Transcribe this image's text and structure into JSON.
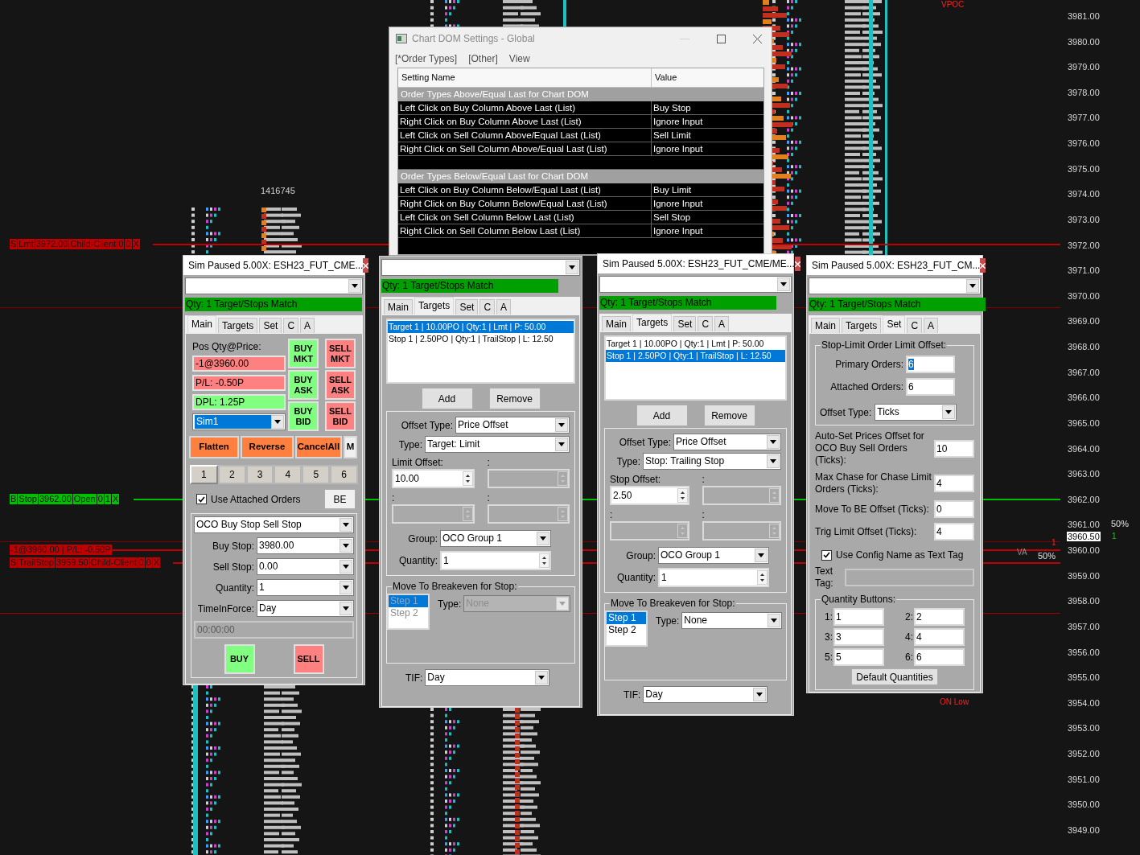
{
  "chart": {
    "price_labels": [
      "3981.00",
      "3980.00",
      "3979.00",
      "3978.00",
      "3977.00",
      "3976.00",
      "3975.00",
      "3974.00",
      "3973.00",
      "3972.00",
      "3971.00",
      "3970.00",
      "3969.00",
      "3968.00",
      "3967.00",
      "3966.00",
      "3965.00",
      "3964.00",
      "3963.00",
      "3962.00",
      "3961.00",
      "3960.00",
      "3959.00",
      "3958.00",
      "3957.00",
      "3956.00",
      "3955.00",
      "3954.00",
      "3953.00",
      "3952.00",
      "3951.00",
      "3950.00",
      "3949.00"
    ],
    "last_price": "3960.50",
    "volume": "1416745",
    "vpoc": "VPOC",
    "on_low": "ON Low",
    "va": "VA",
    "ratios": [
      "50%",
      "50%"
    ],
    "counts": [
      "1",
      "1"
    ],
    "order_labels": [
      {
        "kind": "sell",
        "cells": [
          "S",
          "Lmt",
          "3972.00",
          "Child-Client",
          "0",
          "0",
          "X"
        ]
      },
      {
        "kind": "buy",
        "cells": [
          "B",
          "Stop",
          "3962.00",
          "Open",
          "0",
          "1",
          "X"
        ]
      },
      {
        "kind": "sell",
        "cells": [
          "-1@3960.00 | P/L: -0.50P"
        ]
      },
      {
        "kind": "sell",
        "cells": [
          "S",
          "TrailStop",
          "3959.50",
          "Child-Client",
          "0",
          "0",
          "X"
        ]
      }
    ]
  },
  "settings_dialog": {
    "title": "Chart DOM Settings - Global",
    "menu": [
      "[*Order Types]",
      "[Other]",
      "View"
    ],
    "columns": [
      "Setting Name",
      "Value"
    ],
    "sections": [
      {
        "title": "Order Types Above/Equal Last for Chart DOM",
        "rows": [
          {
            "name": "Left Click on Buy Column Above Last (List)",
            "value": "Buy Stop"
          },
          {
            "name": "Right Click on Buy Column Above Last (List)",
            "value": "Ignore Input"
          },
          {
            "name": "Left Click on Sell Column Above/Equal Last (List)",
            "value": "Sell Limit"
          },
          {
            "name": "Right Click on Sell Column Above/Equal Last (List)",
            "value": "Ignore Input"
          }
        ]
      },
      {
        "title": "Order Types Below/Equal Last for Chart DOM",
        "rows": [
          {
            "name": "Left Click on Buy Column Below/Equal Last (List)",
            "value": "Buy Limit"
          },
          {
            "name": "Right Click on Buy Column Below/Equal Last (List)",
            "value": "Ignore Input"
          },
          {
            "name": "Left Click on Sell Column Below Last (List)",
            "value": "Sell Stop"
          },
          {
            "name": "Right Click on Sell Column Below Last (List)",
            "value": "Ignore Input"
          }
        ]
      }
    ]
  },
  "trade_windows": [
    {
      "title": "Sim Paused 5.00X: ESH23_FUT_CME...",
      "status": "Qty: 1 Target/Stops Match",
      "tabs": [
        {
          "label": "Main",
          "selected": true
        },
        {
          "label": "Targets",
          "selected": false
        },
        {
          "label": "Set",
          "selected": false
        },
        {
          "label": "C",
          "selected": false
        },
        {
          "label": "A",
          "selected": false
        }
      ],
      "panel": {
        "kind": "main",
        "position_label": "Pos Qty@Price:",
        "readouts": [
          {
            "text": "-1@3960.00",
            "kind": "loss"
          },
          {
            "text": "P/L: -0.50P",
            "kind": "loss"
          },
          {
            "text": "DPL: 1.25P",
            "kind": "gain"
          }
        ],
        "account": "Sim1",
        "order_buttons": [
          {
            "label": "BUY MKT",
            "kind": "buy"
          },
          {
            "label": "SELL MKT",
            "kind": "sell"
          },
          {
            "label": "BUY ASK",
            "kind": "buy"
          },
          {
            "label": "SELL ASK",
            "kind": "sell"
          },
          {
            "label": "BUY BID",
            "kind": "buy"
          },
          {
            "label": "SELL BID",
            "kind": "sell"
          }
        ],
        "actions": [
          {
            "label": "Flatten",
            "kind": "accent"
          },
          {
            "label": "Reverse",
            "kind": "accent"
          },
          {
            "label": "CancelAll",
            "kind": "accent"
          },
          {
            "label": "M",
            "kind": "plain"
          }
        ],
        "quantity_buttons": [
          {
            "label": "1",
            "selected": true
          },
          {
            "label": "2",
            "selected": false
          },
          {
            "label": "3",
            "selected": false
          },
          {
            "label": "4",
            "selected": false
          },
          {
            "label": "5",
            "selected": false
          },
          {
            "label": "6",
            "selected": false
          }
        ],
        "attached": {
          "label": "Use Attached Orders",
          "checked": true
        },
        "be_button": "BE",
        "order_type": "OCO Buy Stop Sell Stop",
        "fields": [
          {
            "label": "Buy Stop:",
            "value": "3980.00"
          },
          {
            "label": "Sell Stop:",
            "value": "0.00"
          },
          {
            "label": "Quantity:",
            "value": "1"
          },
          {
            "label": "TimeInForce:",
            "value": "Day"
          }
        ],
        "time": {
          "value": "00:00:00",
          "disabled": true
        },
        "buy": "BUY",
        "sell": "SELL"
      }
    },
    {
      "status": "Qty: 1 Target/Stops Match",
      "tabs": [
        {
          "label": "Main",
          "selected": false
        },
        {
          "label": "Targets",
          "selected": true
        },
        {
          "label": "Set",
          "selected": false
        },
        {
          "label": "C",
          "selected": false
        },
        {
          "label": "A",
          "selected": false
        }
      ],
      "panel": {
        "kind": "targets",
        "orders": [
          {
            "text": "Target 1 | 10.00PO | Qty:1 | Lmt | P: 50.00",
            "selected": true
          },
          {
            "text": "Stop 1 | 2.50PO | Qty:1 | TrailStop | L: 12.50",
            "selected": false
          }
        ],
        "buttons": [
          "Add",
          "Remove"
        ],
        "offset_type": {
          "label": "Offset Type:",
          "value": "Price Offset"
        },
        "type": {
          "label": "Type:",
          "value": "Target: Limit"
        },
        "offsets": [
          {
            "label": "Limit Offset:",
            "value": "10.00",
            "disabled": false
          },
          {
            "label": ":",
            "disabled": true
          },
          {
            "label": ":",
            "disabled": true
          },
          {
            "label": ":",
            "disabled": true
          }
        ],
        "group": {
          "label": "Group:",
          "value": "OCO Group 1"
        },
        "quantity": {
          "label": "Quantity:",
          "value": "1"
        },
        "breakeven": {
          "title": "Move To Breakeven for Stop:",
          "disabled": true,
          "steps": [
            {
              "label": "Step 1",
              "selected": true
            },
            {
              "label": "Step 2",
              "selected": false
            }
          ],
          "type_label": "Type:",
          "type_value": "None"
        },
        "tif": {
          "label": "TIF:",
          "value": "Day"
        }
      }
    },
    {
      "title": "Sim Paused 5.00X: ESH23_FUT_CME/ME...",
      "status": "Qty: 1 Target/Stops Match",
      "tabs": [
        {
          "label": "Main",
          "selected": false
        },
        {
          "label": "Targets",
          "selected": true
        },
        {
          "label": "Set",
          "selected": false
        },
        {
          "label": "C",
          "selected": false
        },
        {
          "label": "A",
          "selected": false
        }
      ],
      "panel": {
        "kind": "targets",
        "orders": [
          {
            "text": "Target 1 | 10.00PO | Qty:1 | Lmt | P: 50.00",
            "selected": false
          },
          {
            "text": "Stop 1 | 2.50PO | Qty:1 | TrailStop | L: 12.50",
            "selected": true
          }
        ],
        "buttons": [
          "Add",
          "Remove"
        ],
        "offset_type": {
          "label": "Offset Type:",
          "value": "Price Offset"
        },
        "type": {
          "label": "Type:",
          "value": "Stop: Trailing Stop"
        },
        "offsets": [
          {
            "label": "Stop Offset:",
            "value": "2.50",
            "disabled": false
          },
          {
            "label": ":",
            "disabled": true
          },
          {
            "label": ":",
            "disabled": true
          },
          {
            "label": ":",
            "disabled": true
          }
        ],
        "group": {
          "label": "Group:",
          "value": "OCO Group 1"
        },
        "quantity": {
          "label": "Quantity:",
          "value": "1"
        },
        "breakeven": {
          "title": "Move To Breakeven for Stop:",
          "disabled": false,
          "steps": [
            {
              "label": "Step 1",
              "selected": true
            },
            {
              "label": "Step 2",
              "selected": false
            }
          ],
          "type_label": "Type:",
          "type_value": "None"
        },
        "tif": {
          "label": "TIF:",
          "value": "Day"
        }
      }
    },
    {
      "title": "Sim Paused 5.00X: ESH23_FUT_CM...",
      "status": "Qty: 1 Target/Stops Match",
      "tabs": [
        {
          "label": "Main",
          "selected": false
        },
        {
          "label": "Targets",
          "selected": false
        },
        {
          "label": "Set",
          "selected": true
        },
        {
          "label": "C",
          "selected": false
        },
        {
          "label": "A",
          "selected": false
        }
      ],
      "panel": {
        "kind": "set",
        "limit_offset": {
          "title": "Stop-Limit Order Limit Offset:",
          "fields": [
            {
              "label": "Primary Orders:",
              "value": "6",
              "selected": true
            },
            {
              "label": "Attached Orders:",
              "value": "6",
              "selected": false
            }
          ],
          "offset_type": {
            "label": "Offset Type:",
            "value": "Ticks"
          }
        },
        "fields": [
          {
            "label": "Auto-Set Prices Offset for OCO Buy Sell Orders (Ticks):",
            "value": "10"
          },
          {
            "label": "Max Chase for Chase Limit Orders (Ticks):",
            "value": "4"
          },
          {
            "label": "Move To BE Offset (Ticks):",
            "value": "0"
          },
          {
            "label": "Trig Limit Offset (Ticks):",
            "value": "4"
          }
        ],
        "config_tag": {
          "label": "Use Config Name as Text Tag",
          "checked": true
        },
        "text_tag": {
          "label": "Text Tag:",
          "disabled": true
        },
        "quantity_buttons": {
          "title": "Quantity Buttons:",
          "fields": [
            {
              "label": "1:",
              "value": "1"
            },
            {
              "label": "2:",
              "value": "2"
            },
            {
              "label": "3:",
              "value": "3"
            },
            {
              "label": "4:",
              "value": "4"
            },
            {
              "label": "5:",
              "value": "5"
            },
            {
              "label": "6:",
              "value": "6"
            }
          ]
        },
        "default_button": "Default Quantities"
      }
    }
  ]
}
